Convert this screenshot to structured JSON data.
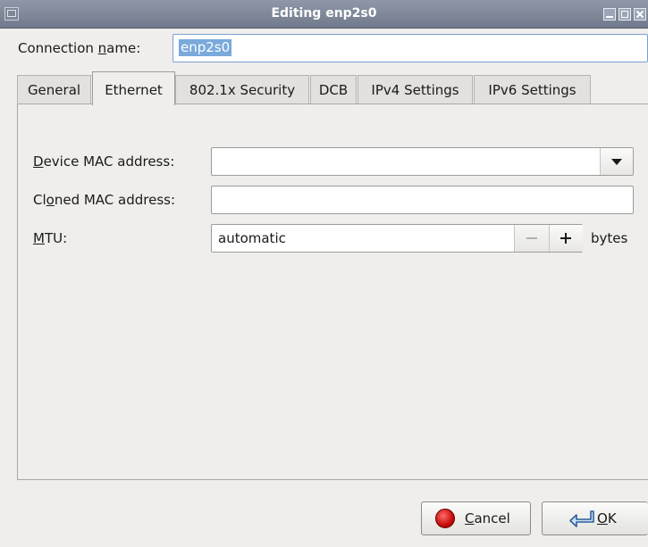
{
  "window": {
    "title": "Editing enp2s0"
  },
  "connection": {
    "label_pre": "Connection ",
    "label_mnemonic": "n",
    "label_post": "ame:",
    "value": "enp2s0"
  },
  "tabs": [
    {
      "label": "General"
    },
    {
      "label": "Ethernet",
      "active": true
    },
    {
      "label": "802.1x Security"
    },
    {
      "label": "DCB"
    },
    {
      "label": "IPv4 Settings"
    },
    {
      "label": "IPv6 Settings"
    }
  ],
  "ethernet": {
    "device_mac": {
      "mnemonic": "D",
      "label_rest": "evice MAC address:",
      "value": ""
    },
    "cloned_mac": {
      "label_pre": "Cl",
      "mnemonic": "o",
      "label_post": "ned MAC address:",
      "value": ""
    },
    "mtu": {
      "mnemonic": "M",
      "label_rest": "TU:",
      "value": "automatic",
      "unit": "bytes"
    }
  },
  "buttons": {
    "cancel": {
      "mnemonic": "C",
      "label_rest": "ancel",
      "icon": "stop-icon"
    },
    "ok": {
      "mnemonic": "O",
      "label_rest": "K",
      "icon": "return-arrow-icon"
    }
  },
  "colors": {
    "titlebar": "#7f8899",
    "selection": "#7aa9dc",
    "window_bg": "#efeeec"
  }
}
